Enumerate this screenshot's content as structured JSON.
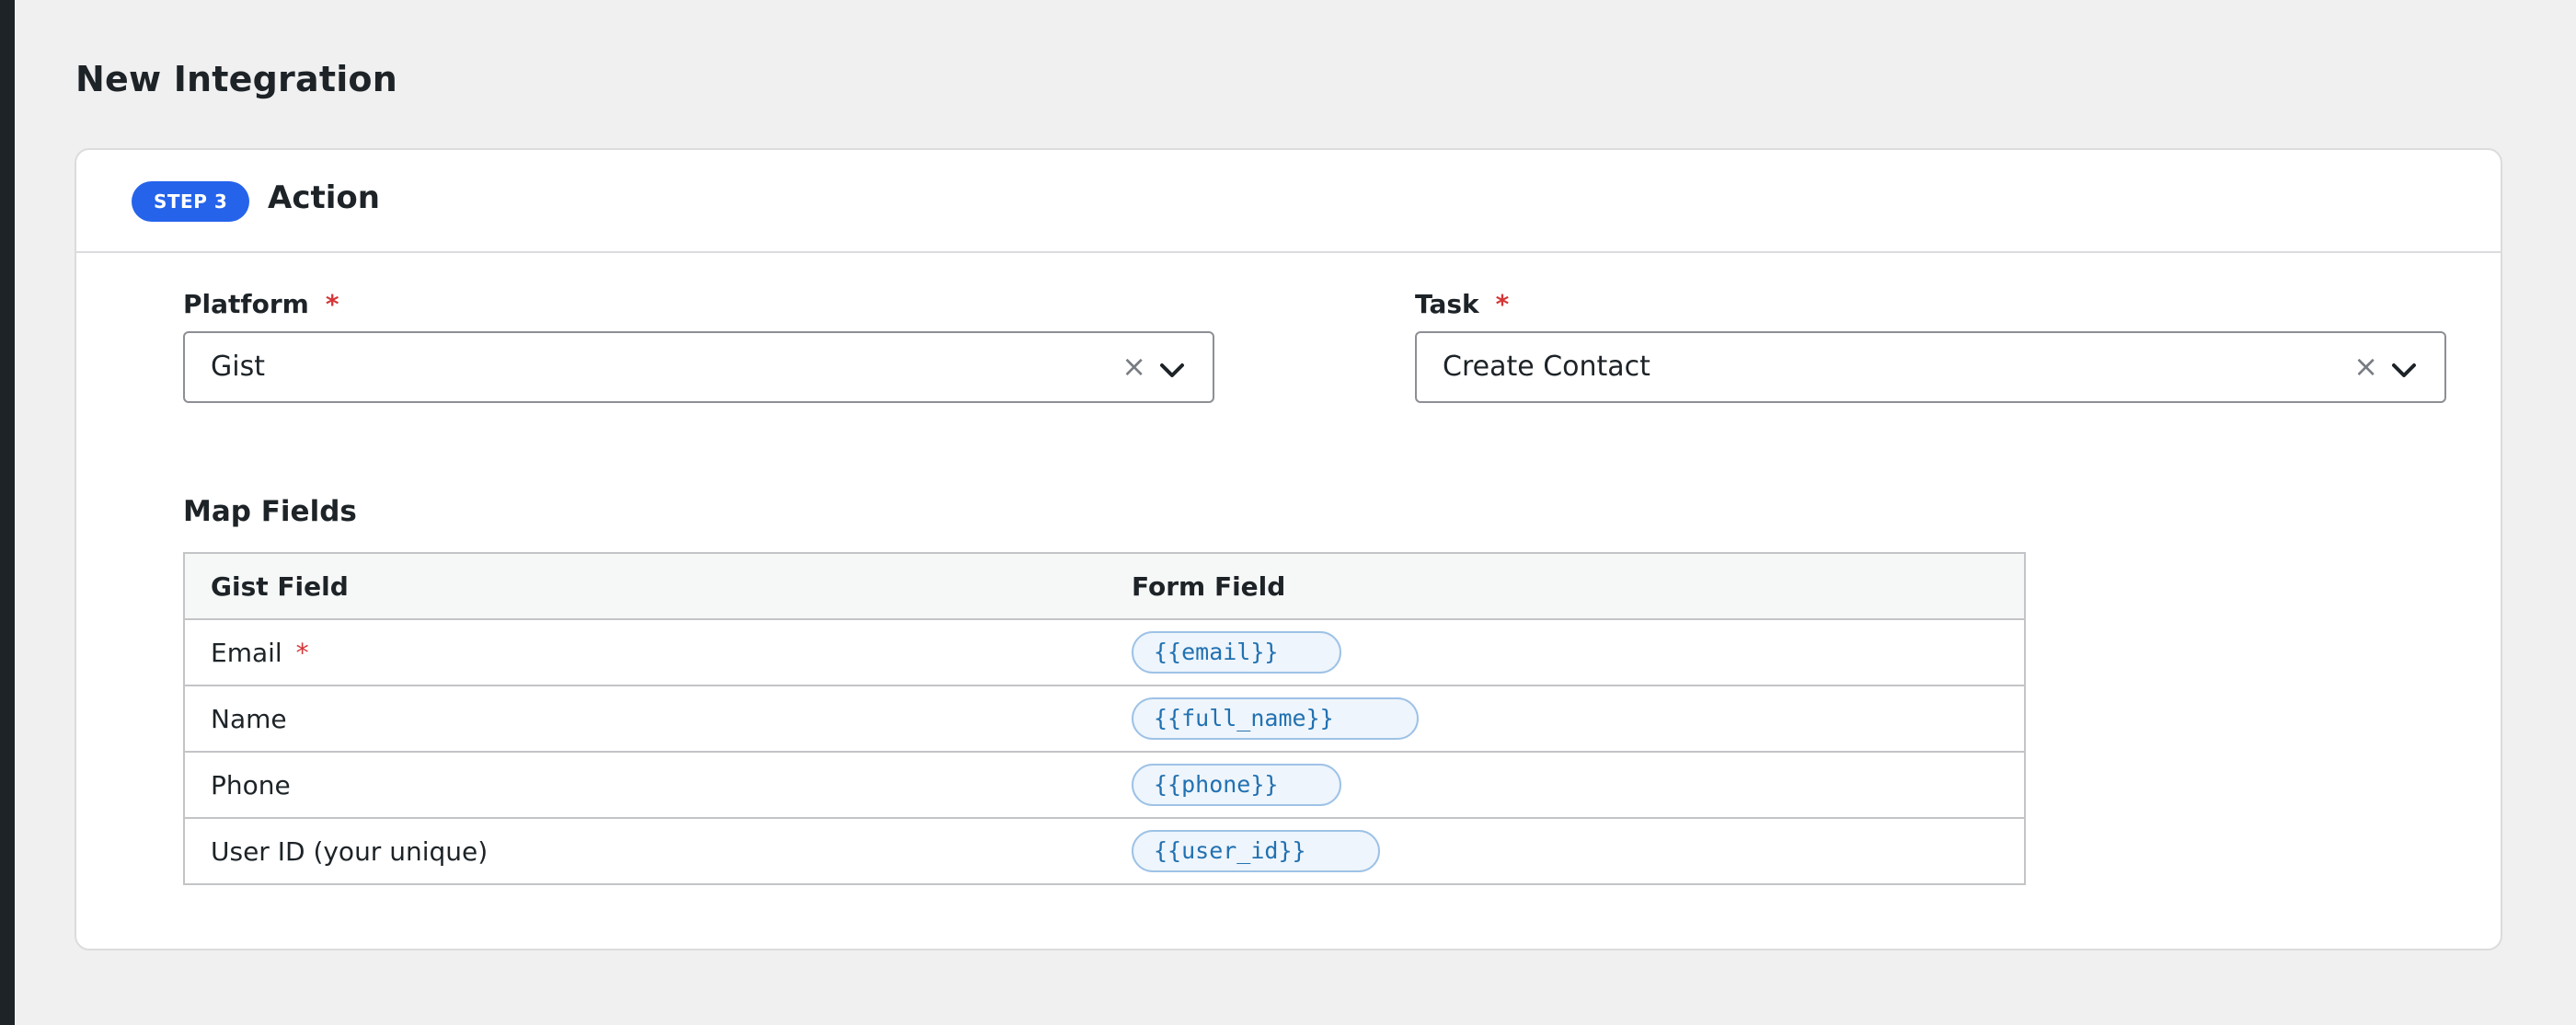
{
  "page": {
    "title": "New Integration"
  },
  "step": {
    "badge": "STEP 3",
    "title": "Action"
  },
  "platform": {
    "label": "Platform",
    "required_mark": "*",
    "value": "Gist",
    "clear": "×"
  },
  "task": {
    "label": "Task",
    "required_mark": "*",
    "value": "Create Contact",
    "clear": "×"
  },
  "map_fields": {
    "title": "Map Fields",
    "columns": [
      "Gist Field",
      "Form Field"
    ],
    "rows": [
      {
        "field": "Email",
        "required_mark": "*",
        "token": "{{email}}"
      },
      {
        "field": "Name",
        "token": "{{full_name}}"
      },
      {
        "field": "Phone",
        "token": "{{phone}}"
      },
      {
        "field": "User ID (your unique)",
        "token": "{{user_id}}"
      }
    ]
  },
  "icons": {
    "clear": "close-icon",
    "dropdown": "chevron-down-icon"
  },
  "colors": {
    "accent": "#2563eb",
    "required": "#d63638",
    "token_text": "#2271b1"
  }
}
